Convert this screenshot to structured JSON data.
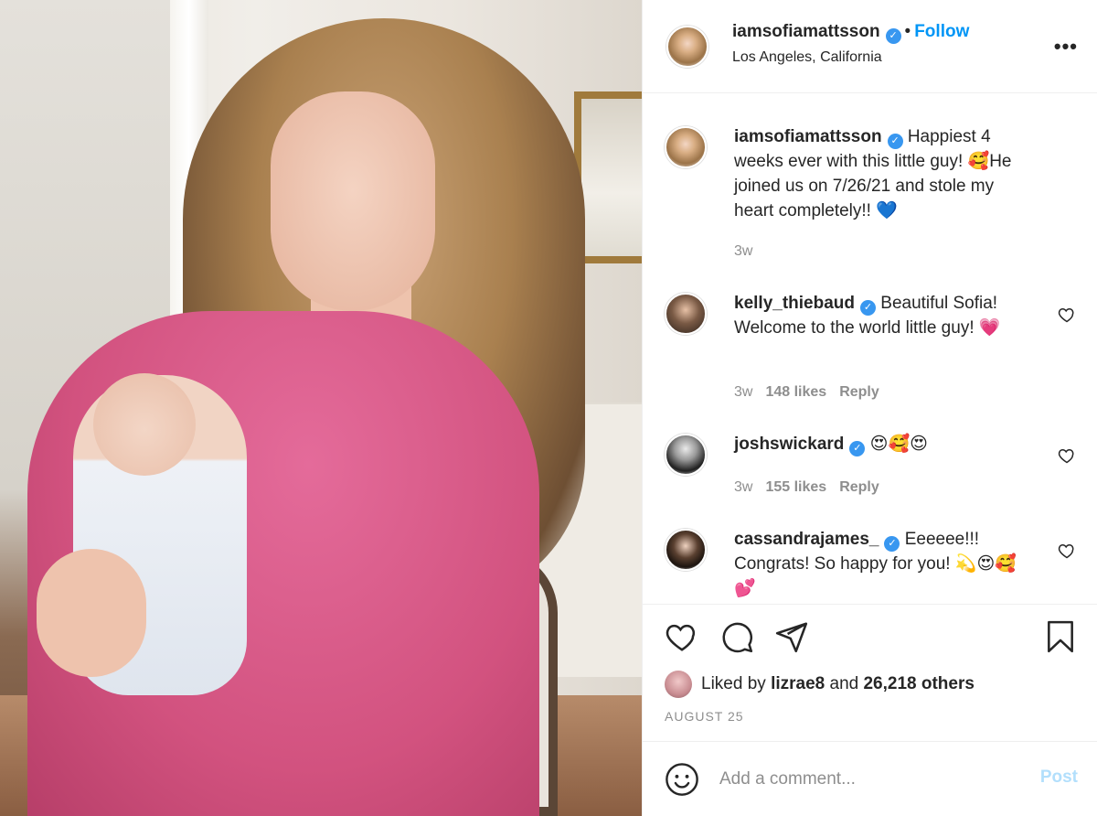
{
  "post": {
    "author": "iamsofiamattsson",
    "location": "Los Angeles, California",
    "follow_label": "Follow",
    "dot": "•",
    "more_label": "•••",
    "verified_mark": "✓"
  },
  "caption": {
    "username": "iamsofiamattsson",
    "text": "Happiest 4 weeks ever with this little guy! 🥰He joined us on 7/26/21 and stole my heart completely!! 💙",
    "time": "3w"
  },
  "comments": [
    {
      "username": "kelly_thiebaud",
      "verified": true,
      "text": "Beautiful Sofia! Welcome to the world little guy! 💗",
      "time": "3w",
      "likes": "148 likes",
      "reply_label": "Reply"
    },
    {
      "username": "joshswickard",
      "verified": true,
      "text": "😍🥰😍",
      "time": "3w",
      "likes": "155 likes",
      "reply_label": "Reply"
    },
    {
      "username": "cassandrajames_",
      "verified": true,
      "text": "Eeeeee!!! Congrats! So happy for you! 💫😍🥰💕"
    }
  ],
  "actions": {
    "icons": [
      "heart-icon",
      "comment-icon",
      "share-icon",
      "bookmark-icon"
    ],
    "liked_by_prefix": "Liked by ",
    "liked_by_user": "lizrae8",
    "liked_by_middle": " and ",
    "liked_by_count": "26,218 others",
    "date": "AUGUST 25"
  },
  "comment_box": {
    "placeholder": "Add a comment...",
    "post_label": "Post"
  },
  "colors": {
    "link": "#0095f6",
    "post_disabled": "#b2dffc",
    "muted": "#8e8e8e",
    "verified": "#3897f0"
  }
}
